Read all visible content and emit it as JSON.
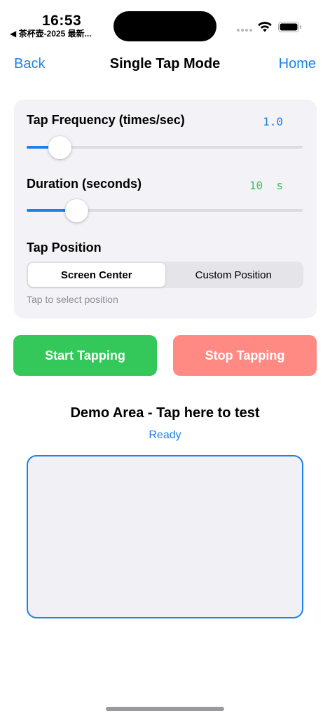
{
  "status_bar": {
    "time": "16:53",
    "back_app": "◀ 茶杯壶-2025 最新...",
    "icons": [
      "signal-icon",
      "wifi-icon",
      "battery-icon"
    ]
  },
  "nav": {
    "back_label": "Back",
    "title": "Single Tap Mode",
    "home_label": "Home"
  },
  "settings": {
    "frequency": {
      "label": "Tap Frequency (times/sec)",
      "value_text": "1.0",
      "level": 0.12,
      "value_color": "#1a82e8"
    },
    "duration": {
      "label": "Duration (seconds)",
      "value_text": "10  s",
      "level": 0.18,
      "value_color": "#34c759"
    },
    "position": {
      "label": "Tap Position",
      "options": [
        "Screen Center",
        "Custom Position"
      ],
      "selected": "Screen Center",
      "hint": "Tap to select position"
    }
  },
  "actions": {
    "start_label": "Start Tapping",
    "stop_label": "Stop Tapping"
  },
  "demo": {
    "title": "Demo Area - Tap here to test",
    "status": "Ready"
  },
  "colors": {
    "accent": "#1a82e8",
    "start": "#34c759",
    "stop": "#ff8a84"
  }
}
